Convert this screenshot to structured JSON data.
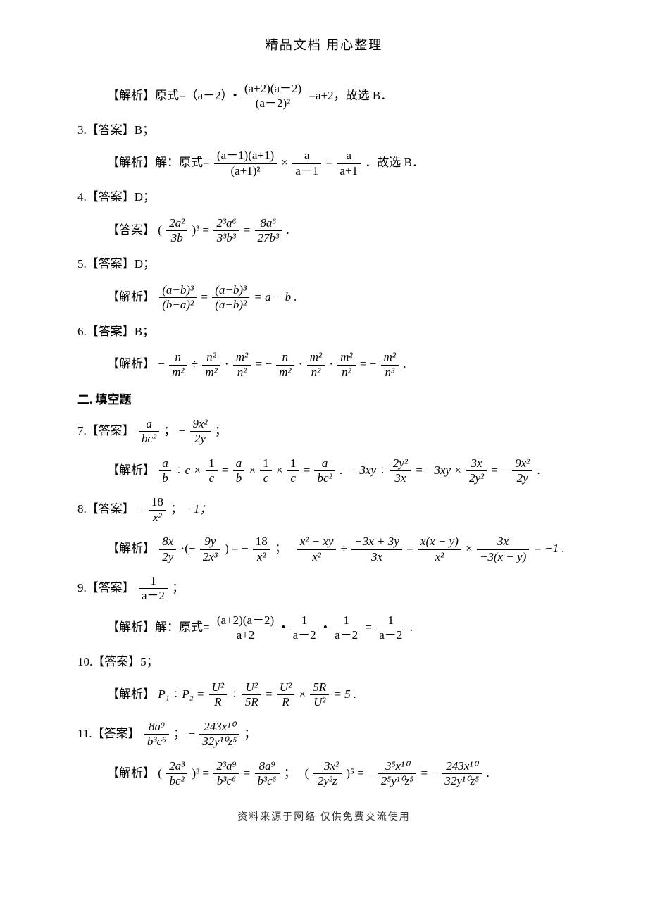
{
  "header": "精品文档 用心整理",
  "footer": "资料来源于网络 仅供免费交流使用",
  "section_fill": "二. 填空题",
  "items": {
    "i2": {
      "analysis_label": "【解析】原式=（a－2）•",
      "frac_num": "(a+2)(a－2)",
      "frac_den": "(a－2)²",
      "tail": "=a+2，故选 B．"
    },
    "i3": {
      "line1": "3.【答案】B；",
      "analysis_label": "【解析】解：原式=",
      "f1_num": "(a－1)(a+1)",
      "f1_den": "(a+1)²",
      "times": "×",
      "f2_num": "a",
      "f2_den": "a－1",
      "eq": "=",
      "f3_num": "a",
      "f3_den": "a+1",
      "tail": "．故选 B．"
    },
    "i4": {
      "line1": "4.【答案】D；",
      "answer_label": "【答案】",
      "lhs_num": "2a²",
      "lhs_den": "3b",
      "pow": ")³ =",
      "mid_num": "2³a⁶",
      "mid_den": "3³b³",
      "eq": "=",
      "rhs_num": "8a⁶",
      "rhs_den": "27b³",
      "dot": "."
    },
    "i5": {
      "line1": "5.【答案】D；",
      "analysis_label": "【解析】",
      "f1_num": "(a−b)³",
      "f1_den": "(b−a)²",
      "eq1": "=",
      "f2_num": "(a−b)³",
      "f2_den": "(a−b)²",
      "eq2": "= a − b .",
      "dot": ""
    },
    "i6": {
      "line1": "6.【答案】B；",
      "analysis_label": "【解析】",
      "t1": "−",
      "f1_num": "n",
      "f1_den": "m²",
      "div": "÷",
      "f2_num": "n²",
      "f2_den": "m²",
      "dot1": "·",
      "f3_num": "m²",
      "f3_den": "n²",
      "eq1": "= −",
      "f4_num": "n",
      "f4_den": "m²",
      "dot2": "·",
      "f5_num": "m²",
      "f5_den": "n²",
      "dot3": "·",
      "f6_num": "m²",
      "f6_den": "n²",
      "eq2": "= −",
      "f7_num": "m²",
      "f7_den": "n³",
      "tail": "."
    },
    "i7": {
      "answer_label": "7.【答案】",
      "a1_num": "a",
      "a1_den": "bc²",
      "sep": "；",
      "neg": "−",
      "a2_num": "9x²",
      "a2_den": "2y",
      "semi": "；",
      "analysis_label": "【解析】",
      "p1_f1_num": "a",
      "p1_f1_den": "b",
      "p1_div": "÷ c ×",
      "p1_f2_num": "1",
      "p1_f2_den": "c",
      "p1_eq1": "=",
      "p1_f3_num": "a",
      "p1_f3_den": "b",
      "p1_x1": "×",
      "p1_f4_num": "1",
      "p1_f4_den": "c",
      "p1_x2": "×",
      "p1_f5_num": "1",
      "p1_f5_den": "c",
      "p1_eq2": "=",
      "p1_f6_num": "a",
      "p1_f6_den": "bc²",
      "p1_dot": ".",
      "p2_lead": "−3xy ÷",
      "p2_f1_num": "2y²",
      "p2_f1_den": "3x",
      "p2_eq1": "= −3xy ×",
      "p2_f2_num": "3x",
      "p2_f2_den": "2y²",
      "p2_eq2": "= −",
      "p2_f3_num": "9x²",
      "p2_f3_den": "2y",
      "p2_dot": "."
    },
    "i8": {
      "answer_label": "8.【答案】",
      "neg": "−",
      "a1_num": "18",
      "a1_den": "x²",
      "sep": "；",
      "a2": "−1；",
      "analysis_label": "【解析】",
      "p1_f1_num": "8x",
      "p1_f1_den": "2y",
      "p1_dot1": "·(−",
      "p1_f2_num": "9y",
      "p1_f2_den": "2x³",
      "p1_close": ") = −",
      "p1_f3_num": "18",
      "p1_f3_den": "x²",
      "p1_semi": "；",
      "p2_f1_num": "x² − xy",
      "p2_f1_den": "x²",
      "p2_div": "÷",
      "p2_f2_num": "−3x + 3y",
      "p2_f2_den": "3x",
      "p2_eq1": "=",
      "p2_f3_num": "x(x − y)",
      "p2_f3_den": "x²",
      "p2_x": "×",
      "p2_f4_num": "3x",
      "p2_f4_den": "−3(x − y)",
      "p2_eq2": "= −1 ."
    },
    "i9": {
      "answer_label": "9.【答案】",
      "a_num": "1",
      "a_den": "a－2",
      "semi": "；",
      "analysis_label": "【解析】解：原式=",
      "f1_num": "(a+2)(a－2)",
      "f1_den": "a+2",
      "dot1": "•",
      "f2_num": "1",
      "f2_den": "a－2",
      "dot2": "•",
      "f3_num": "1",
      "f3_den": "a－2",
      "eq": "=",
      "f4_num": "1",
      "f4_den": "a－2",
      "tail": "."
    },
    "i10": {
      "line1": "10.【答案】5；",
      "analysis_label": "【解析】",
      "lead": "P₁ ÷ P₂ =",
      "f1_num": "U²",
      "f1_den": "R",
      "div": "÷",
      "f2_num": "U²",
      "f2_den": "5R",
      "eq1": "=",
      "f3_num": "U²",
      "f3_den": "R",
      "x": "×",
      "f4_num": "5R",
      "f4_den": "U²",
      "eq2": "= 5 ."
    },
    "i11": {
      "answer_label": "11.【答案】",
      "a1_num": "8a⁹",
      "a1_den": "b³c⁶",
      "sep": "；",
      "neg": "−",
      "a2_num": "243x¹⁰",
      "a2_den": "32y¹⁰z⁵",
      "semi": "；",
      "analysis_label": "【解析】",
      "p1_open": "(",
      "p1_f1_num": "2a³",
      "p1_f1_den": "bc²",
      "p1_pow": ")³ =",
      "p1_f2_num": "2³a⁹",
      "p1_f2_den": "b³c⁶",
      "p1_eq": "=",
      "p1_f3_num": "8a⁹",
      "p1_f3_den": "b³c⁶",
      "p1_semi": "；",
      "p2_open": "(",
      "p2_f1_num": "−3x²",
      "p2_f1_den": "2y²z",
      "p2_pow": ")⁵ = −",
      "p2_f2_num": "3⁵x¹⁰",
      "p2_f2_den": "2⁵y¹⁰z⁵",
      "p2_eq": "= −",
      "p2_f3_num": "243x¹⁰",
      "p2_f3_den": "32y¹⁰z⁵",
      "p2_dot": "."
    }
  }
}
